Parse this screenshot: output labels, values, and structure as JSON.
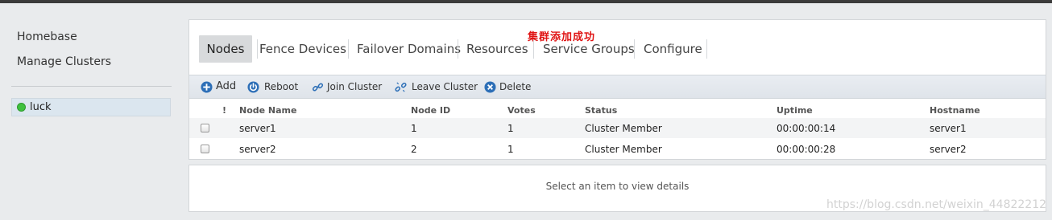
{
  "sidebar": {
    "homebase": "Homebase",
    "manage_clusters": "Manage Clusters",
    "clusters": [
      {
        "name": "luck",
        "status_color": "#3fc13f"
      }
    ]
  },
  "banner": {
    "message": "集群添加成功",
    "color": "#e01414"
  },
  "tabs": [
    "Nodes",
    "Fence Devices",
    "Failover Domains",
    "Resources",
    "Service Groups",
    "Configure"
  ],
  "active_tab": "Nodes",
  "toolbar": {
    "add": {
      "label": "Add",
      "icon": "plus-circle-icon"
    },
    "reboot": {
      "label": "Reboot",
      "icon": "power-icon"
    },
    "join": {
      "label": "Join Cluster",
      "icon": "link-icon"
    },
    "leave": {
      "label": "Leave Cluster",
      "icon": "unlink-icon"
    },
    "delete": {
      "label": "Delete",
      "icon": "x-circle-icon"
    }
  },
  "table": {
    "columns": [
      "!",
      "Node Name",
      "Node ID",
      "Votes",
      "Status",
      "Uptime",
      "Hostname"
    ],
    "rows": [
      {
        "node_name": "server1",
        "node_id": "1",
        "votes": "1",
        "status": "Cluster Member",
        "uptime": "00:00:00:14",
        "hostname": "server1"
      },
      {
        "node_name": "server2",
        "node_id": "2",
        "votes": "1",
        "status": "Cluster Member",
        "uptime": "00:00:00:28",
        "hostname": "server2"
      }
    ]
  },
  "details": {
    "placeholder": "Select an item to view details"
  },
  "watermark": "https://blog.csdn.net/weixin_44822212"
}
